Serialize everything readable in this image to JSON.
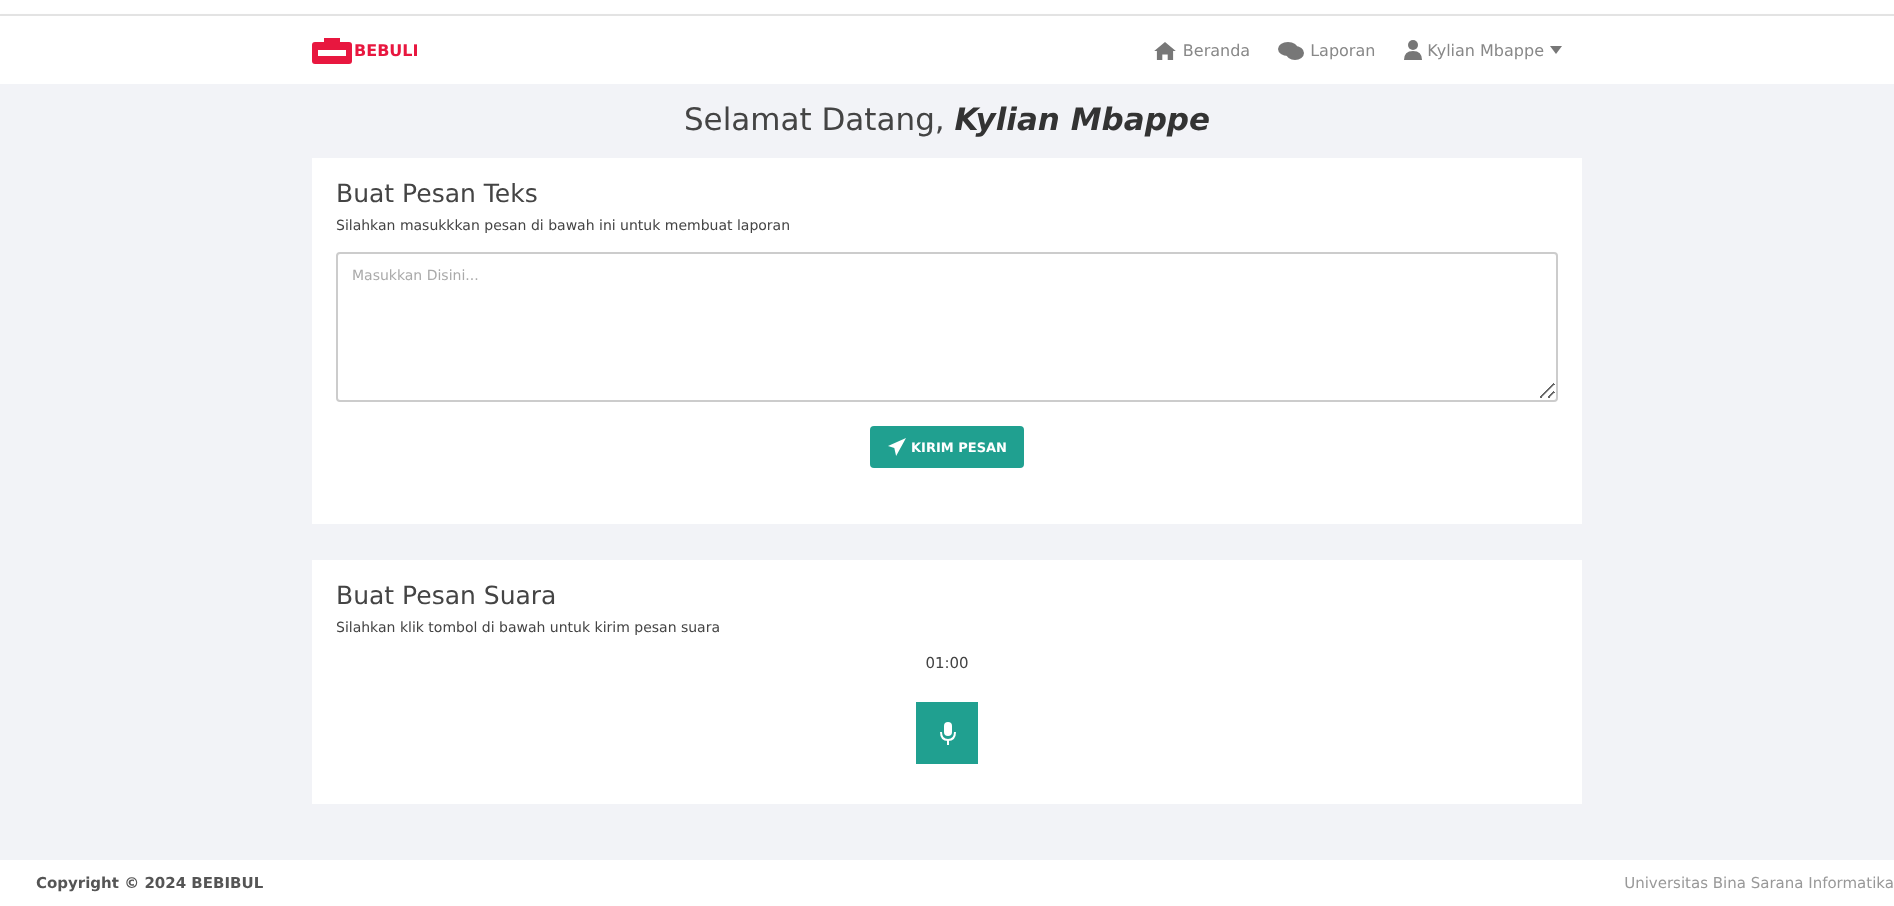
{
  "brand": {
    "name": "BEBULI"
  },
  "nav": [
    {
      "kind": "home",
      "label": "Beranda"
    },
    {
      "kind": "chat",
      "label": "Laporan"
    },
    {
      "kind": "user",
      "label": "Kylian Mbappe",
      "dropdown": true
    }
  ],
  "welcome": {
    "prefix": "Selamat Datang,",
    "name": "Kylian Mbappe"
  },
  "text_card": {
    "title": "Buat Pesan Teks",
    "subtitle": "Silahkan masukkkan pesan di bawah ini untuk membuat laporan",
    "placeholder": "Masukkan Disini...",
    "button": "KIRIM PESAN"
  },
  "voice_card": {
    "title": "Buat Pesan Suara",
    "subtitle": "Silahkan klik tombol di bawah untuk kirim pesan suara",
    "timer": "01:00"
  },
  "footer": {
    "copyright": "Copyright © 2024 BEBIBUL",
    "credit": "Universitas Bina Sarana Informatika"
  }
}
